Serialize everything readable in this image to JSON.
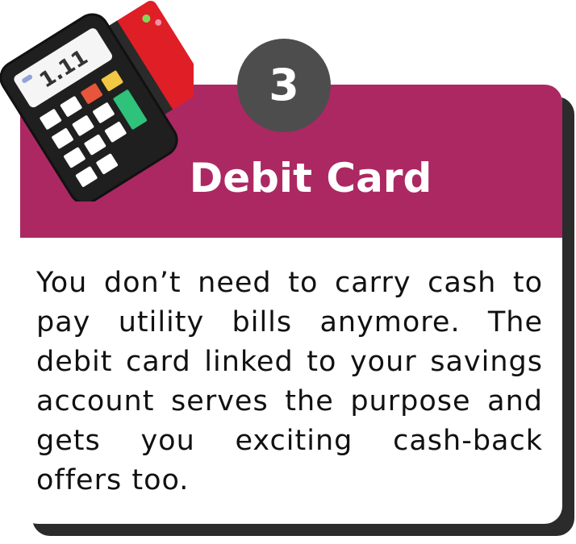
{
  "step": {
    "number": "3"
  },
  "card": {
    "title": "Debit Card",
    "body": "You don’t need to carry cash to pay utility bills anymore. The debit card linked to your savings account serves the purpose and gets you exciting cash-back offers too."
  },
  "terminal": {
    "display_text": "1.11"
  },
  "colors": {
    "header": "#ac2862",
    "badge": "#4d4d4d",
    "card_stripe": "#e01e26",
    "terminal_body": "#1f1f1f",
    "key_red": "#e8553b",
    "key_yellow": "#f2c744",
    "key_green": "#2ec27a",
    "shadow": "#2b2b2b"
  }
}
